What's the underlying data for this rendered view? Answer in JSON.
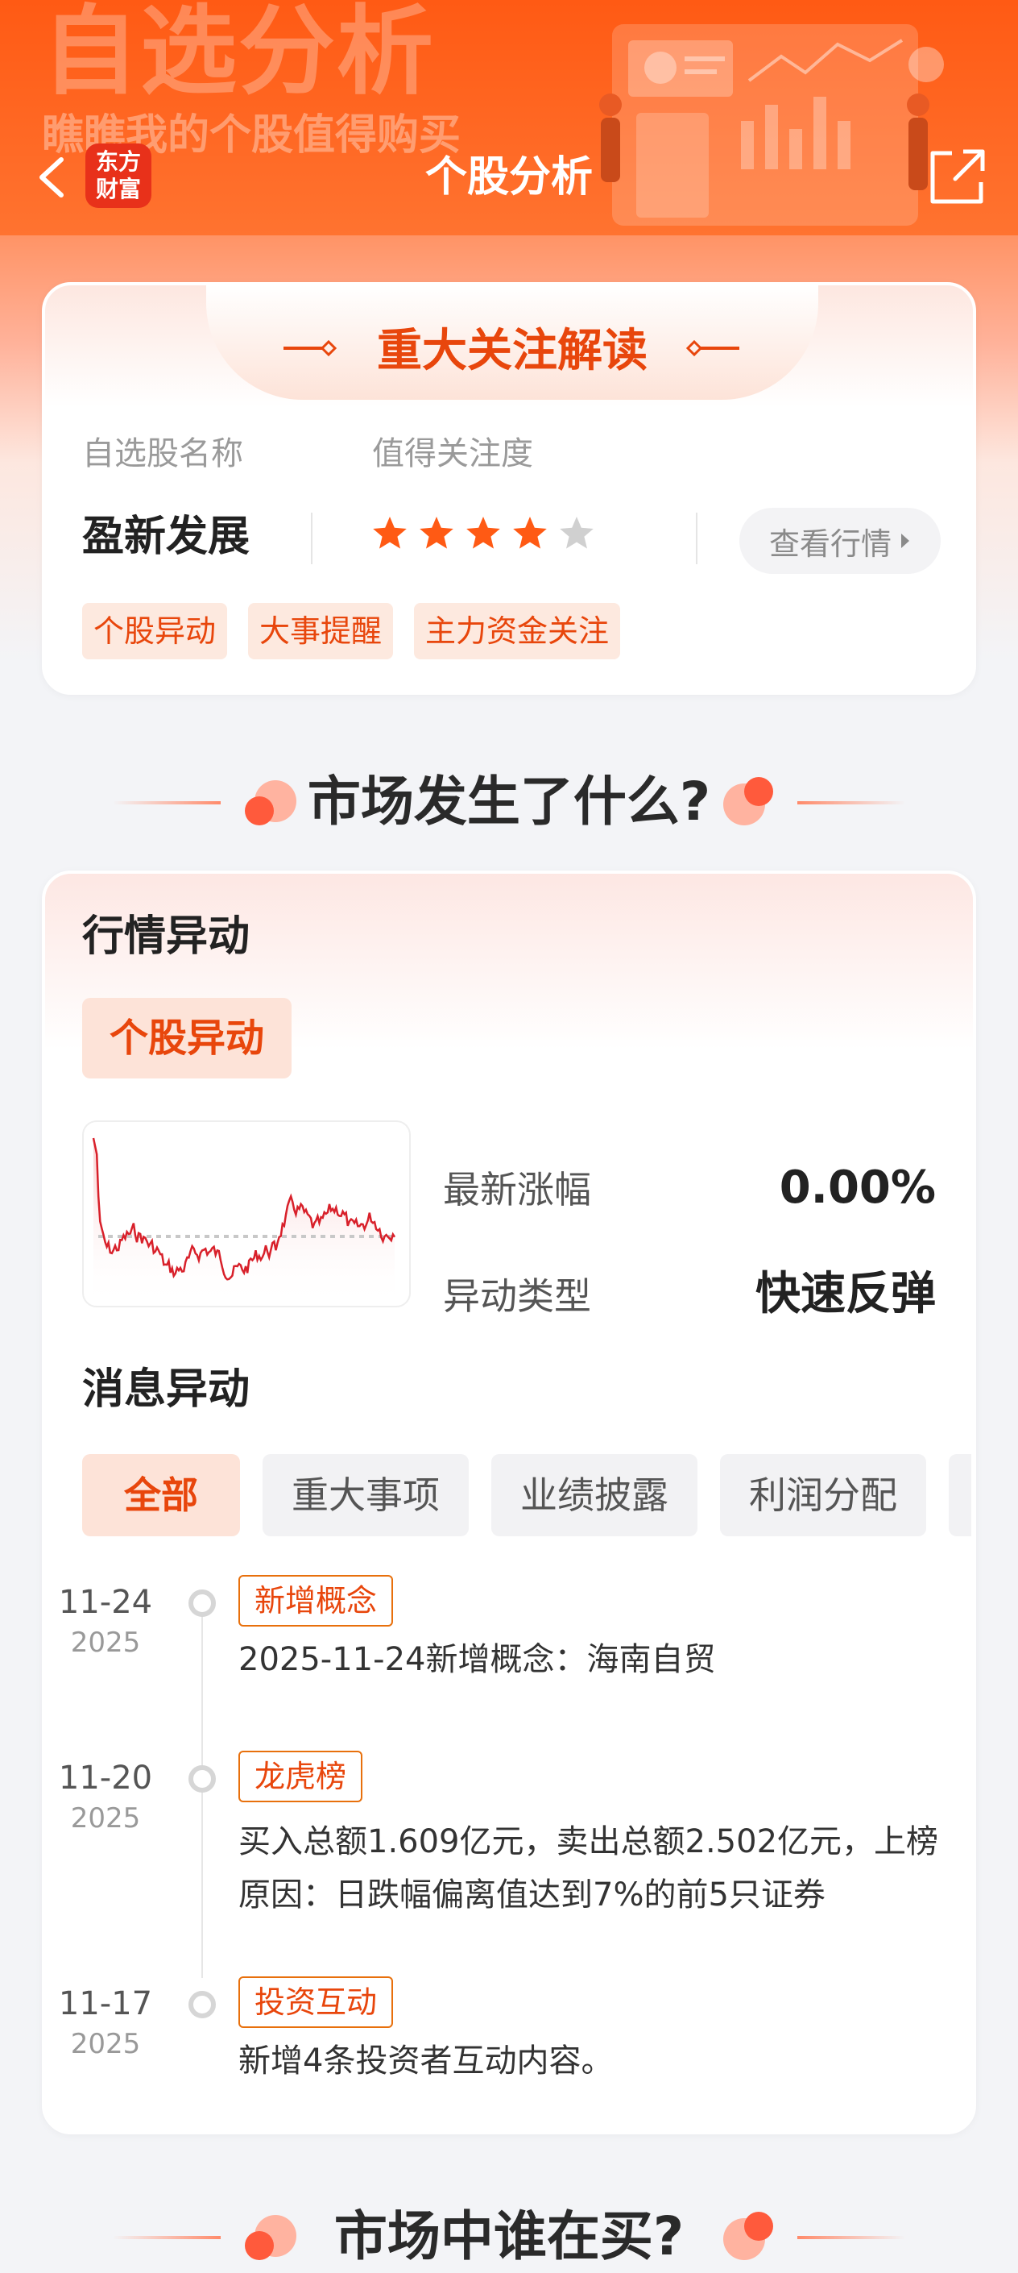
{
  "header": {
    "bg_title": "自选分析",
    "bg_subtitle": "瞧瞧我的个股值得购买",
    "logo_line1": "东方",
    "logo_line2": "财富",
    "title": "个股分析"
  },
  "focus_card": {
    "title": "重大关注解读",
    "name_label": "自选股名称",
    "attention_label": "值得关注度",
    "stock_name": "盈新发展",
    "rating": 4,
    "rating_max": 5,
    "quote_button": "查看行情",
    "tags": [
      "个股异动",
      "大事提醒",
      "主力资金关注"
    ]
  },
  "section_what": {
    "title": "市场发生了什么?"
  },
  "market_card": {
    "quote_title": "行情异动",
    "quote_tab": "个股异动",
    "change_label": "最新涨幅",
    "change_value": "0.00%",
    "type_label": "异动类型",
    "type_value": "快速反弹",
    "news_title": "消息异动",
    "filters": [
      "全部",
      "重大事项",
      "业绩披露",
      "利润分配",
      ""
    ],
    "active_filter": 0,
    "timeline": [
      {
        "date": "11-24",
        "year": "2025",
        "tag": "新增概念",
        "text": "2025-11-24新增概念：海南自贸"
      },
      {
        "date": "11-20",
        "year": "2025",
        "tag": "龙虎榜",
        "text": "买入总额1.609亿元，卖出总额2.502亿元，上榜原因：日跌幅偏离值达到7%的前5只证券"
      },
      {
        "date": "11-17",
        "year": "2025",
        "tag": "投资互动",
        "text": "新增4条投资者互动内容。"
      }
    ]
  },
  "section_who": {
    "title": "市场中谁在买?"
  },
  "colors": {
    "brand_orange": "#ff5a14",
    "accent": "#e8460c",
    "tag_bg": "#fde9df",
    "star_on": "#ff5a14",
    "star_off": "#d0d0d0",
    "chart_line": "#d8202a"
  }
}
